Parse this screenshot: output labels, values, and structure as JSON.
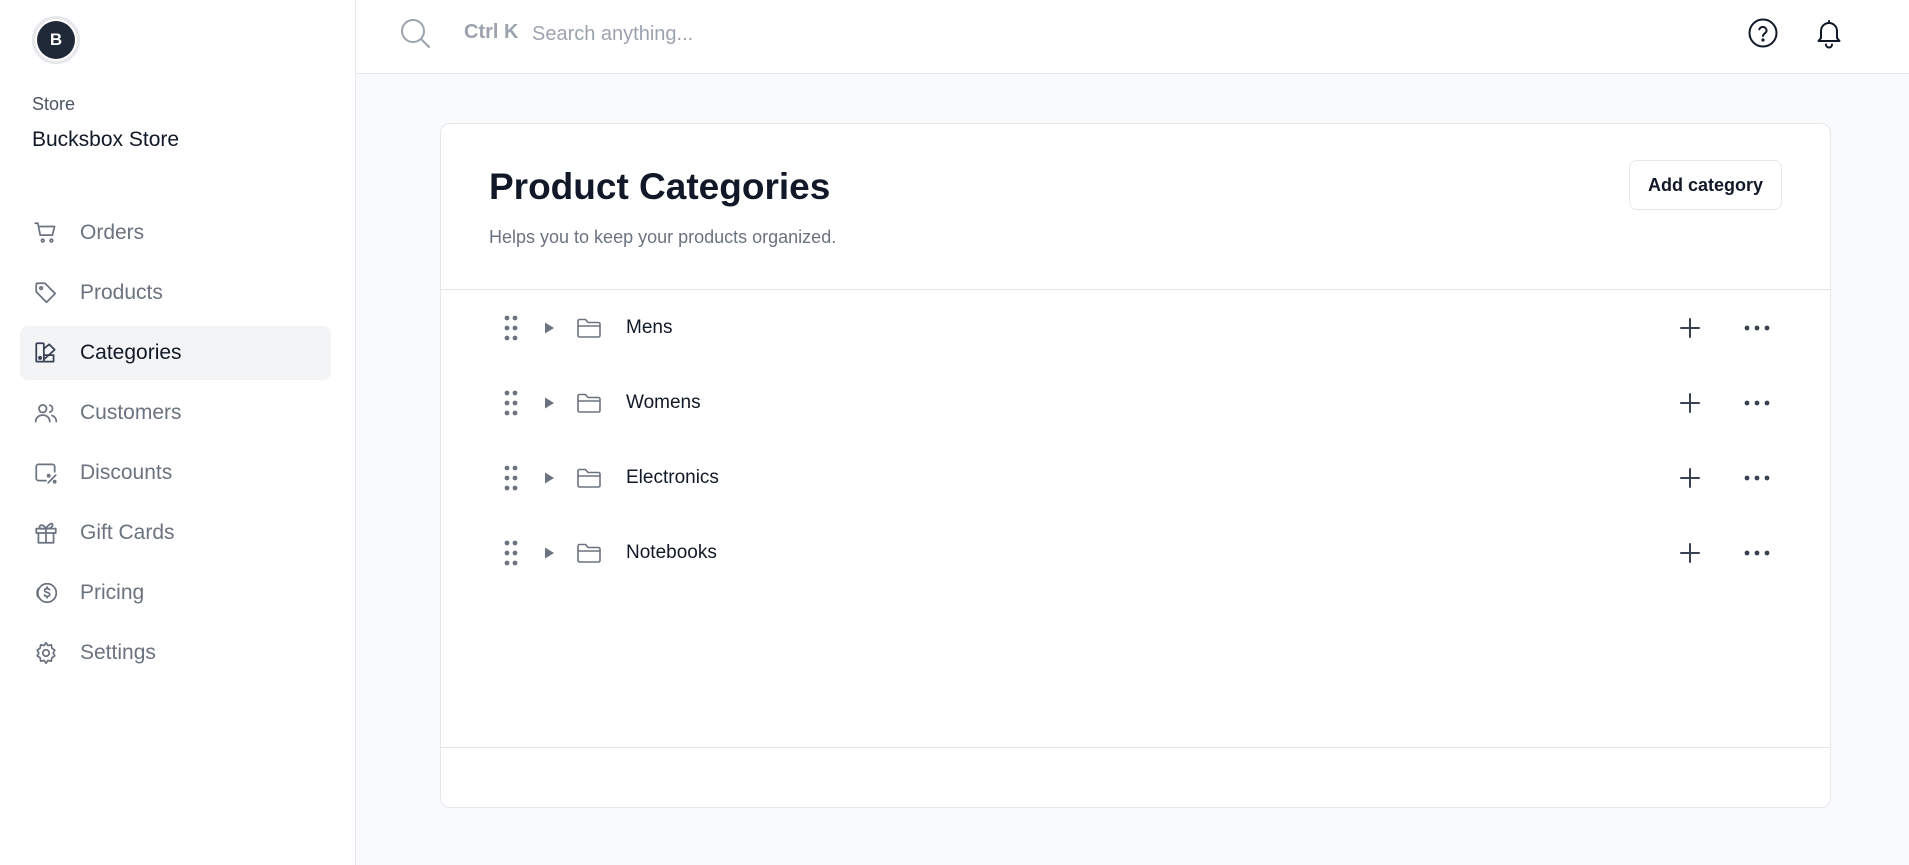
{
  "store": {
    "avatar_initial": "B",
    "label": "Store",
    "name": "Bucksbox Store"
  },
  "sidebar": {
    "items": [
      {
        "label": "Orders",
        "icon": "cart-icon",
        "active": false
      },
      {
        "label": "Products",
        "icon": "tag-icon",
        "active": false
      },
      {
        "label": "Categories",
        "icon": "categories-icon",
        "active": true
      },
      {
        "label": "Customers",
        "icon": "users-icon",
        "active": false
      },
      {
        "label": "Discounts",
        "icon": "discount-icon",
        "active": false
      },
      {
        "label": "Gift Cards",
        "icon": "gift-icon",
        "active": false
      },
      {
        "label": "Pricing",
        "icon": "pricing-icon",
        "active": false
      },
      {
        "label": "Settings",
        "icon": "gear-icon",
        "active": false
      }
    ]
  },
  "topbar": {
    "search_shortcut": "Ctrl K",
    "search_placeholder": "Search anything..."
  },
  "main": {
    "title": "Product Categories",
    "subtitle": "Helps you to keep your products organized.",
    "add_button_label": "Add category",
    "categories": [
      {
        "name": "Mens"
      },
      {
        "name": "Womens"
      },
      {
        "name": "Electronics"
      },
      {
        "name": "Notebooks"
      }
    ]
  },
  "colors": {
    "background": "#f9fafb",
    "surface": "#ffffff",
    "border": "#e5e7eb",
    "text_primary": "#111827",
    "text_muted": "#6b7280",
    "active_nav_bg": "#f3f4f6"
  }
}
